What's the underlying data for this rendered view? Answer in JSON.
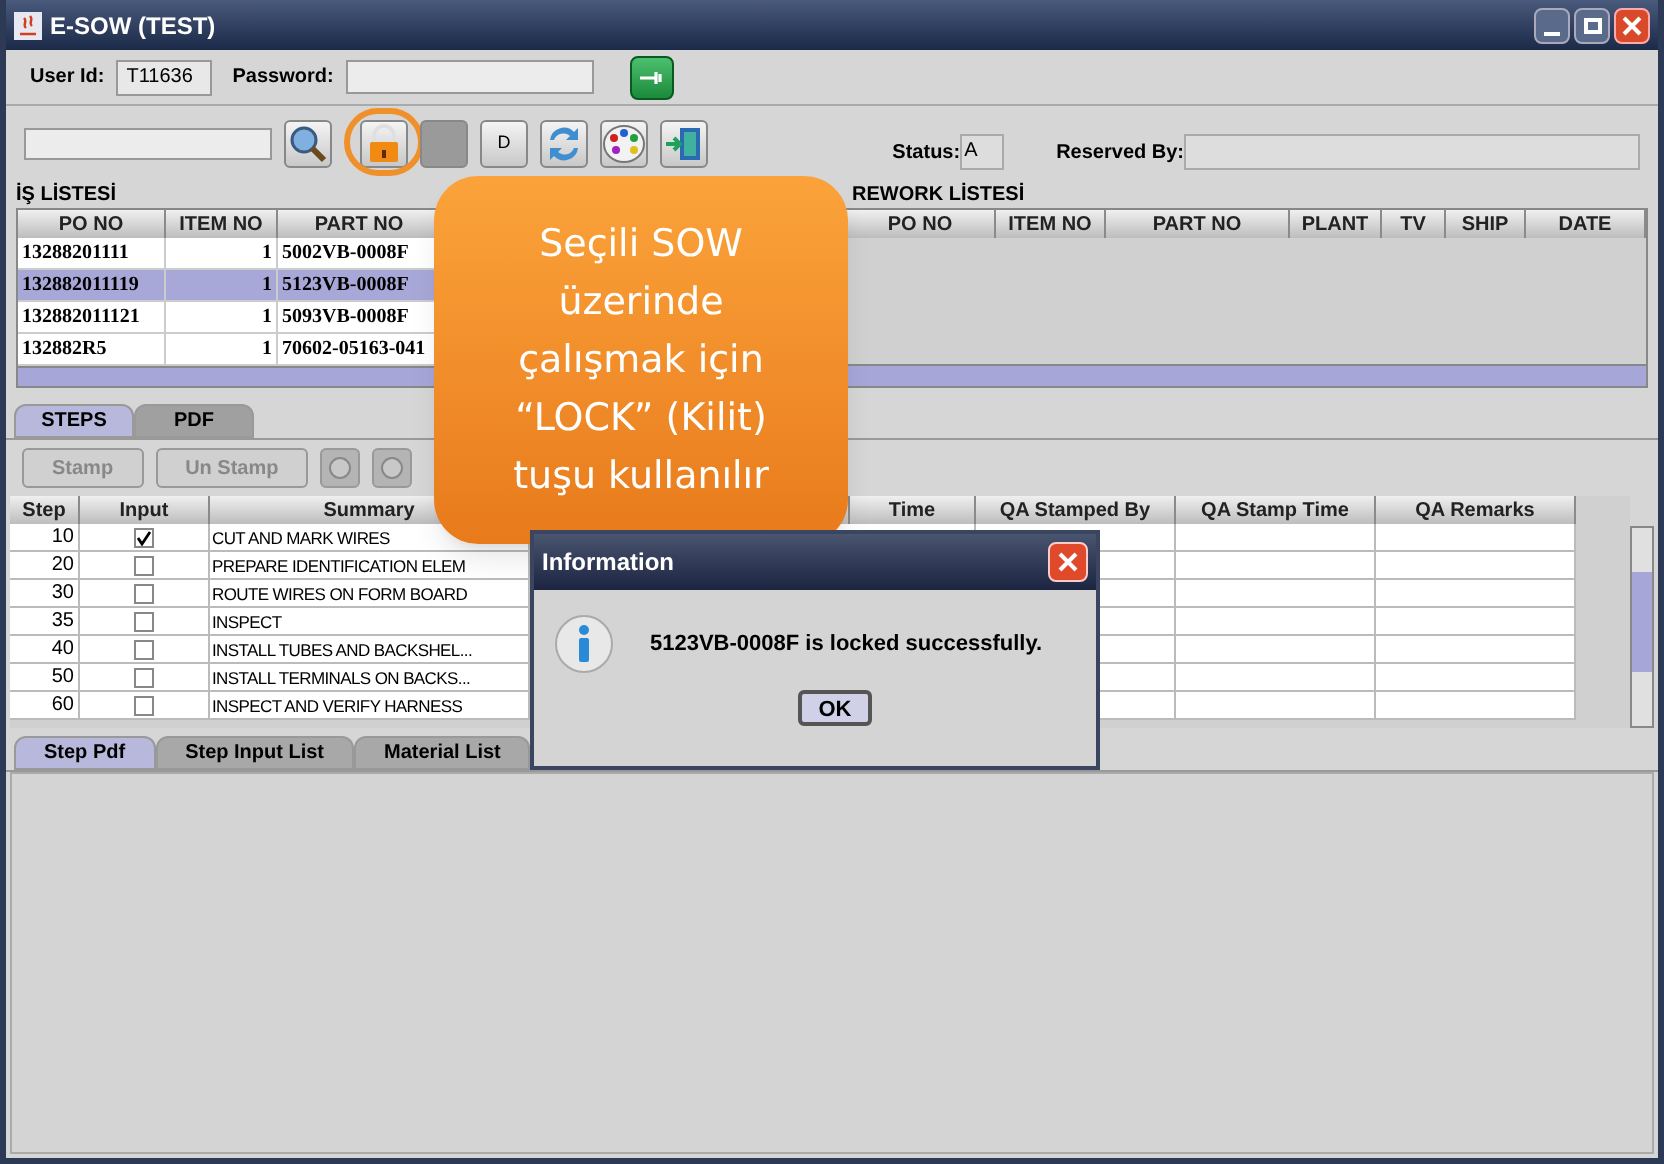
{
  "window": {
    "title": "E-SOW (TEST)"
  },
  "login": {
    "user_id_label": "User Id:",
    "user_id": "T11636",
    "password_label": "Password:"
  },
  "toolbar": {
    "buttons": [
      {
        "kind": "search",
        "highlighted": false
      },
      {
        "kind": "lock",
        "highlighted": true
      },
      {
        "kind": "blank",
        "highlighted": false
      },
      {
        "kind": "text",
        "label": "D",
        "highlighted": false
      },
      {
        "kind": "refresh",
        "highlighted": false
      },
      {
        "kind": "palette",
        "highlighted": false
      },
      {
        "kind": "exit",
        "highlighted": false
      }
    ],
    "status_label": "Status:",
    "status": "A",
    "reserved_by_label": "Reserved By:"
  },
  "work_list": {
    "title": "İŞ LİSTESİ",
    "columns": [
      "PO NO",
      "ITEM NO",
      "PART NO"
    ],
    "rows": [
      {
        "cells": [
          "13288201111",
          "1",
          "5002VB-0008F"
        ],
        "selected": false
      },
      {
        "cells": [
          "132882011119",
          "1",
          "5123VB-0008F"
        ],
        "selected": true
      },
      {
        "cells": [
          "132882011121",
          "1",
          "5093VB-0008F"
        ],
        "selected": false
      },
      {
        "cells": [
          "132882R5",
          "1",
          "70602-05163-041"
        ],
        "selected": false
      }
    ]
  },
  "rework_list": {
    "title": "REWORK LİSTESİ",
    "columns": [
      "PO NO",
      "ITEM NO",
      "PART NO",
      "PLANT",
      "TV",
      "SHIP",
      "DATE"
    ]
  },
  "callout": {
    "text": "Seçili SOW üzerinde çalışmak için “LOCK” (Kilit) tuşu kullanılır"
  },
  "top_tabs": [
    {
      "label": "STEPS",
      "selected": true
    },
    {
      "label": "PDF",
      "selected": false
    }
  ],
  "step_buttons": [
    {
      "kind": "text",
      "label": "Stamp",
      "disabled": true
    },
    {
      "kind": "text",
      "label": "Un Stamp",
      "disabled": true
    },
    {
      "kind": "icon",
      "disabled": true
    },
    {
      "kind": "icon",
      "disabled": true
    }
  ],
  "steps_table": {
    "columns": [
      "Step",
      "Input",
      "Summary",
      "Time",
      "QA Stamped By",
      "QA Stamp Time",
      "QA Remarks"
    ],
    "rows": [
      {
        "step": "10",
        "input": true,
        "summary": "CUT AND MARK WIRES"
      },
      {
        "step": "20",
        "input": false,
        "summary": "PREPARE IDENTIFICATION ELEM"
      },
      {
        "step": "30",
        "input": false,
        "summary": "ROUTE WIRES ON FORM BOARD"
      },
      {
        "step": "35",
        "input": false,
        "summary": "INSPECT"
      },
      {
        "step": "40",
        "input": false,
        "summary": "INSTALL TUBES AND BACKSHEL..."
      },
      {
        "step": "50",
        "input": false,
        "summary": "INSTALL TERMINALS ON BACKS..."
      },
      {
        "step": "60",
        "input": false,
        "summary": "INSPECT AND VERIFY HARNESS"
      }
    ]
  },
  "bottom_tabs": [
    {
      "label": "Step Pdf",
      "selected": true
    },
    {
      "label": "Step Input List",
      "selected": false
    },
    {
      "label": "Material List",
      "selected": false
    }
  ],
  "dialog": {
    "title": "Information",
    "message": "5123VB-0008F is locked successfully.",
    "button": "OK"
  }
}
